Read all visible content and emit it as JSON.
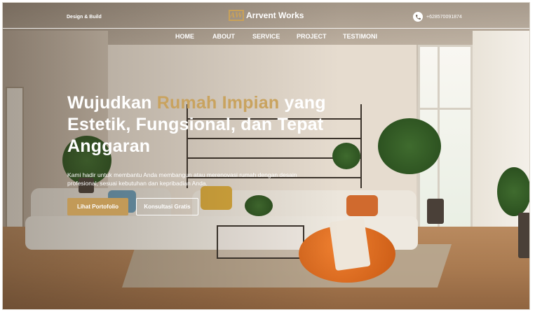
{
  "header": {
    "tagline": "Design & Build",
    "logo_mark": "AW",
    "logo_text": "Arrvent Works",
    "phone": "+628570091874"
  },
  "nav": {
    "items": [
      "HOME",
      "ABOUT",
      "SERVICE",
      "PROJECT",
      "TESTIMONI"
    ]
  },
  "hero": {
    "title_before": "Wujudkan ",
    "title_accent": "Rumah Impian",
    "title_after": " yang Estetik, Fungsional, dan Tepat Anggaran",
    "description": "Kami hadir untuk membantu Anda membangun atau merenovasi rumah dengan desain profesional, sesuai kebutuhan dan kepribadian Anda.",
    "primary_button": "Lihat Portofolio",
    "secondary_button": "Konsultasi Gratis"
  },
  "colors": {
    "accent": "#c9a35f",
    "button": "#c29a58",
    "text": "#ffffff"
  }
}
